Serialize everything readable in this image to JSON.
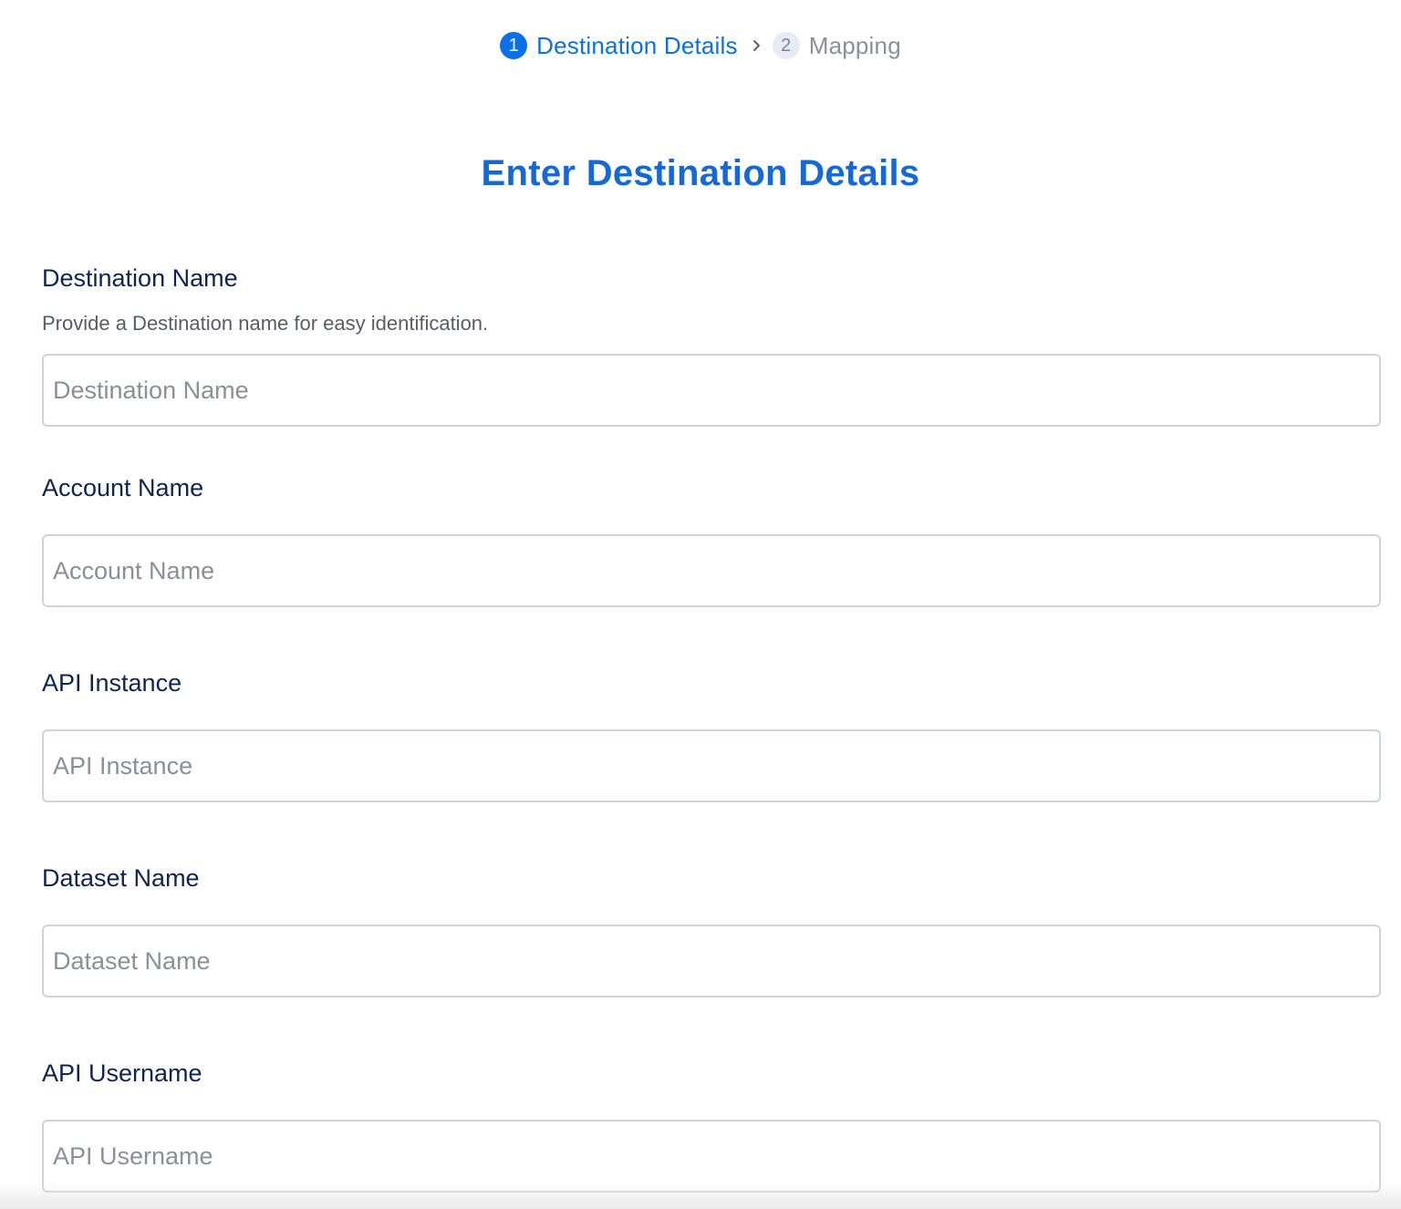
{
  "stepper": {
    "steps": [
      {
        "number": "1",
        "label": "Destination Details",
        "state": "active"
      },
      {
        "number": "2",
        "label": "Mapping",
        "state": "inactive"
      }
    ],
    "separator_icon": "chevron-right-icon"
  },
  "page_title": "Enter Destination Details",
  "colors": {
    "accent": "#0b6fe8",
    "label": "#0d2550",
    "placeholder": "#8a8f98"
  },
  "form": {
    "destination_name": {
      "label": "Destination Name",
      "help": "Provide a Destination name for easy identification.",
      "value": "",
      "placeholder": "Destination Name"
    },
    "account_name": {
      "label": "Account Name",
      "value": "",
      "placeholder": "Account Name"
    },
    "api_instance": {
      "label": "API Instance",
      "value": "",
      "placeholder": "API Instance"
    },
    "dataset_name": {
      "label": "Dataset Name",
      "value": "",
      "placeholder": "Dataset Name"
    },
    "api_username": {
      "label": "API Username",
      "value": "",
      "placeholder": "API Username"
    }
  }
}
